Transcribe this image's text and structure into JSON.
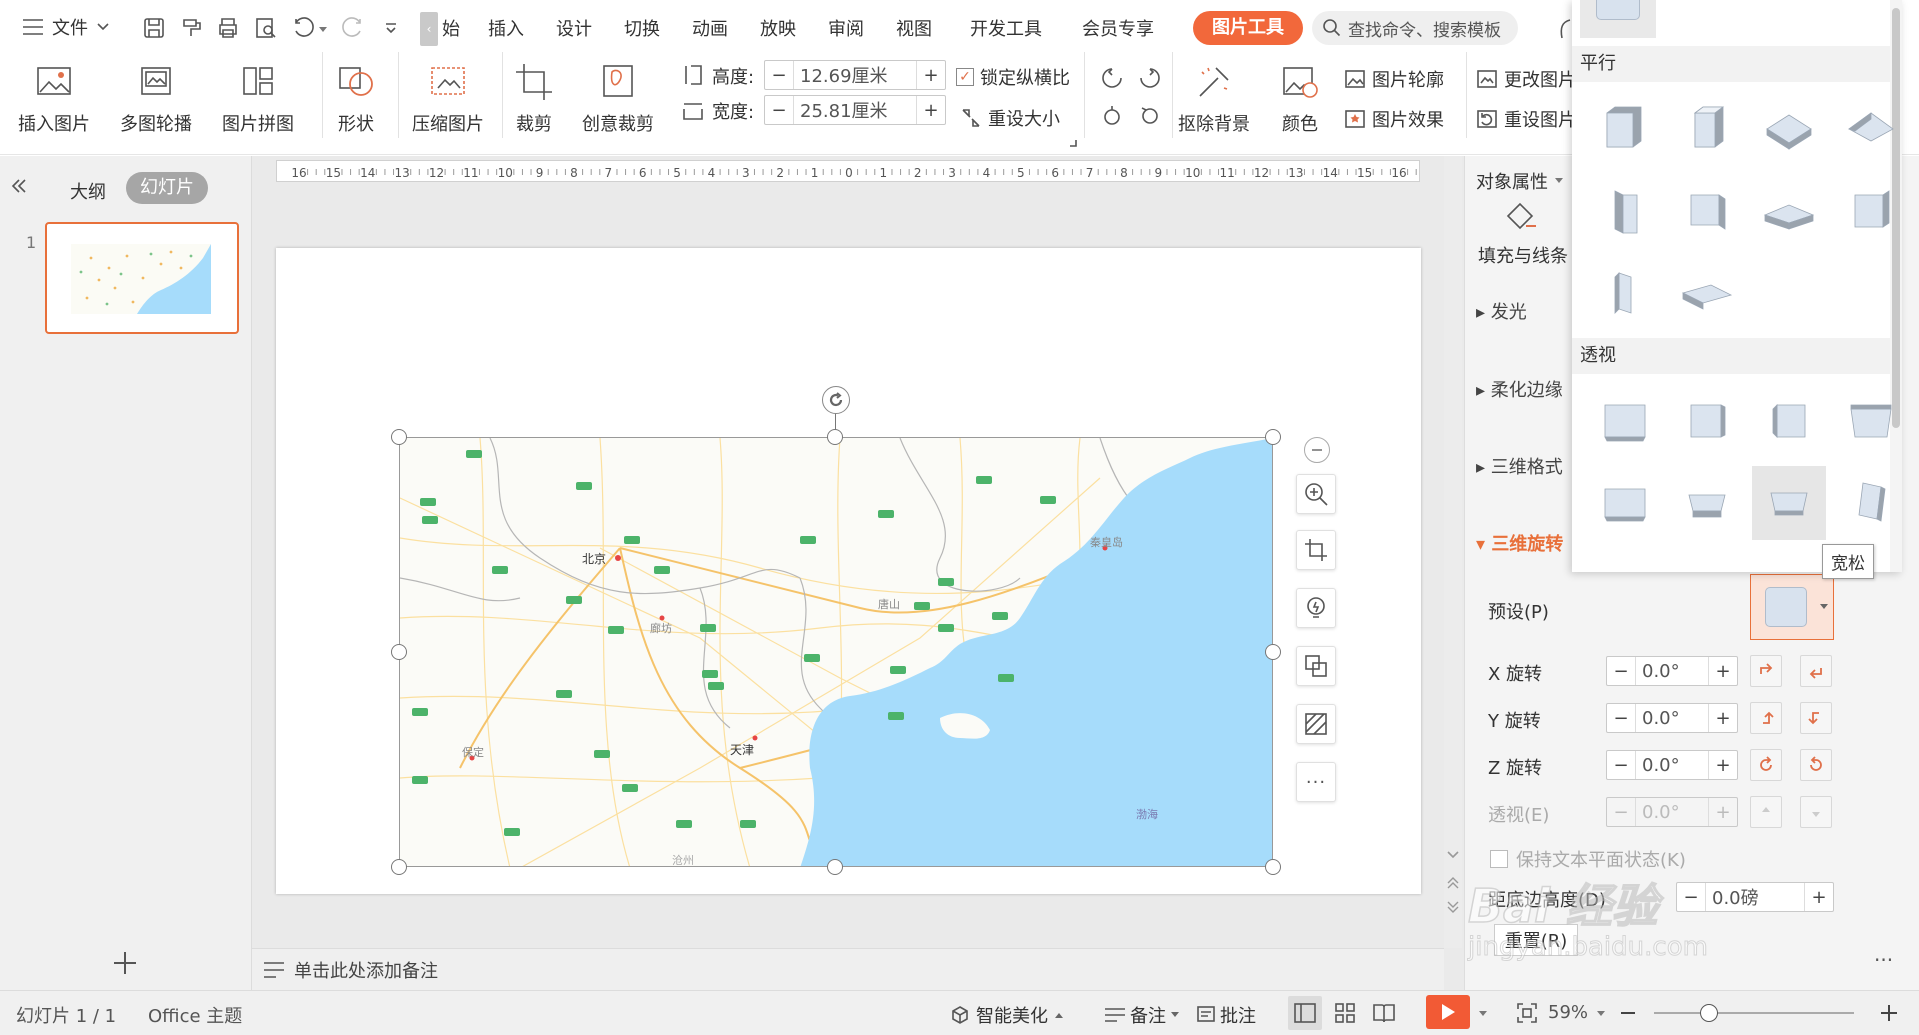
{
  "colors": {
    "accent": "#e8703a",
    "tool_tab": "#f2683b",
    "sea": "#a6dcfb",
    "land": "#fbfbf7",
    "play": "#f25a35"
  },
  "menu": {
    "file": "文件",
    "tabs": [
      "始",
      "插入",
      "设计",
      "切换",
      "动画",
      "放映",
      "审阅",
      "视图",
      "开发工具",
      "会员专享"
    ],
    "tool_tab": "图片工具",
    "search_placeholder": "查找命令、搜索模板"
  },
  "ribbon": {
    "insert_picture": "插入图片",
    "multi_carousel": "多图轮播",
    "picture_collage": "图片拼图",
    "shape": "形状",
    "compress": "压缩图片",
    "crop": "裁剪",
    "creative_crop": "创意裁剪",
    "height_label": "高度:",
    "height_value": "12.69厘米",
    "width_label": "宽度:",
    "width_value": "25.81厘米",
    "lock_ratio": "锁定纵横比",
    "reset_size": "重设大小",
    "remove_bg": "抠除背景",
    "color": "颜色",
    "outline": "图片轮廓",
    "effect": "图片效果",
    "change_picture": "更改图片",
    "reset_picture": "重设图片"
  },
  "left_panel": {
    "outline_tab": "大纲",
    "slides_tab": "幻灯片",
    "slide_number": "1"
  },
  "ruler": {
    "ticks": [
      "16",
      "15",
      "14",
      "13",
      "12",
      "11",
      "10",
      "9",
      "8",
      "7",
      "6",
      "5",
      "4",
      "3",
      "2",
      "1",
      "0",
      "1",
      "2",
      "3",
      "4",
      "5",
      "6",
      "7",
      "8",
      "9",
      "10",
      "11",
      "12",
      "13",
      "14",
      "15",
      "16"
    ]
  },
  "map": {
    "beijing": "北京",
    "tianjin": "天津",
    "tangshan": "唐山",
    "qinhuangdao": "秦皇岛",
    "langfang": "廊坊",
    "baoding": "保定",
    "bohai": "渤海",
    "cangzhou": "沧州"
  },
  "notes_placeholder": "单击此处添加备注",
  "right_panel": {
    "object_props": "对象属性",
    "fill_line": "填充与线条",
    "glow": "发光",
    "soft_edge": "柔化边缘",
    "format_3d": "三维格式",
    "rotation_3d": "三维旋转",
    "preset": "预设(P)",
    "x_rot": "X 旋转",
    "y_rot": "Y 旋转",
    "z_rot": "Z 旋转",
    "perspective": "透视(E)",
    "x_val": "0.0°",
    "y_val": "0.0°",
    "z_val": "0.0°",
    "p_val": "0.0°",
    "keep_text_flat": "保持文本平面状态(K)",
    "distance": "距底边高度(D)",
    "distance_val": "0.0磅",
    "reset": "重置(R)"
  },
  "dropdown": {
    "parallel": "平行",
    "perspective": "透视",
    "tooltip": "宽松"
  },
  "status": {
    "slide_info": "幻灯片 1 / 1",
    "theme": "Office 主题",
    "beautify": "智能美化",
    "notes": "备注",
    "comment": "批注",
    "zoom": "59%",
    "more": "···"
  },
  "watermark": {
    "line1": "Bai 经验",
    "line2": "jingyan.baidu.com"
  }
}
